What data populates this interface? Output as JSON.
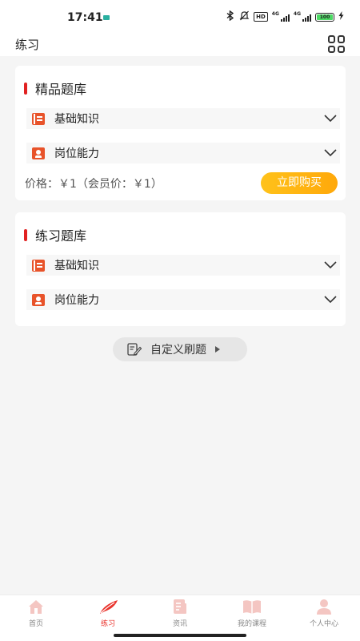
{
  "status_bar": {
    "time": "17:41",
    "hd": "HD",
    "sig1": "4G",
    "sig2": "4G",
    "battery": "100"
  },
  "header": {
    "title": "练习"
  },
  "premium_bank": {
    "title": "精品题库",
    "items": [
      {
        "label": "基础知识",
        "icon": "book-icon"
      },
      {
        "label": "岗位能力",
        "icon": "job-icon"
      }
    ],
    "price_text": "价格：￥1（会员价：￥1）",
    "buy_label": "立即购买"
  },
  "practice_bank": {
    "title": "练习题库",
    "items": [
      {
        "label": "基础知识",
        "icon": "book-icon"
      },
      {
        "label": "岗位能力",
        "icon": "job-icon"
      }
    ]
  },
  "custom_practice": {
    "label": "自定义刷题"
  },
  "tabs": [
    {
      "label": "首页",
      "icon": "home-icon",
      "active": false
    },
    {
      "label": "练习",
      "icon": "feather-icon",
      "active": true
    },
    {
      "label": "资讯",
      "icon": "news-icon",
      "active": false
    },
    {
      "label": "我的课程",
      "icon": "course-icon",
      "active": false
    },
    {
      "label": "个人中心",
      "icon": "profile-icon",
      "active": false
    }
  ],
  "colors": {
    "accent": "#e9332c",
    "buy_button": "#ffb010",
    "item_icon": "#e8532a",
    "inactive_tab_icon": "#f4c6c2"
  }
}
